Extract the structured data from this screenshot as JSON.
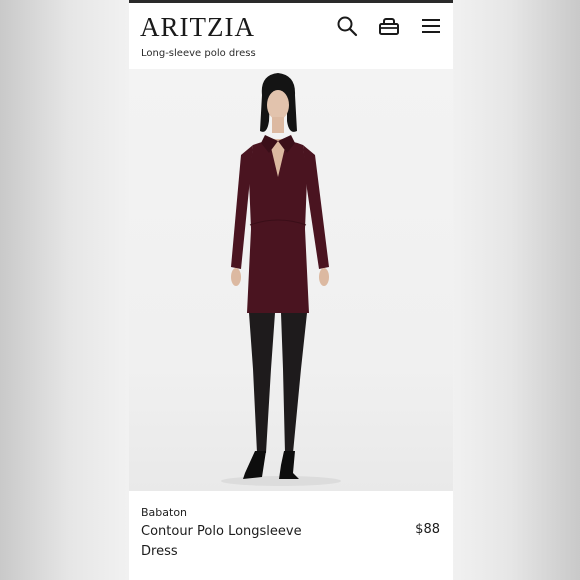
{
  "header": {
    "logo": "ARITZIA",
    "subtitle": "Long-sleeve polo dress",
    "icons": [
      "search-icon",
      "bag-icon",
      "menu-icon"
    ]
  },
  "product": {
    "brand": "Babaton",
    "name": "Contour Polo Longsleeve Dress",
    "price": "$88",
    "color_hex": "#4a1420"
  }
}
